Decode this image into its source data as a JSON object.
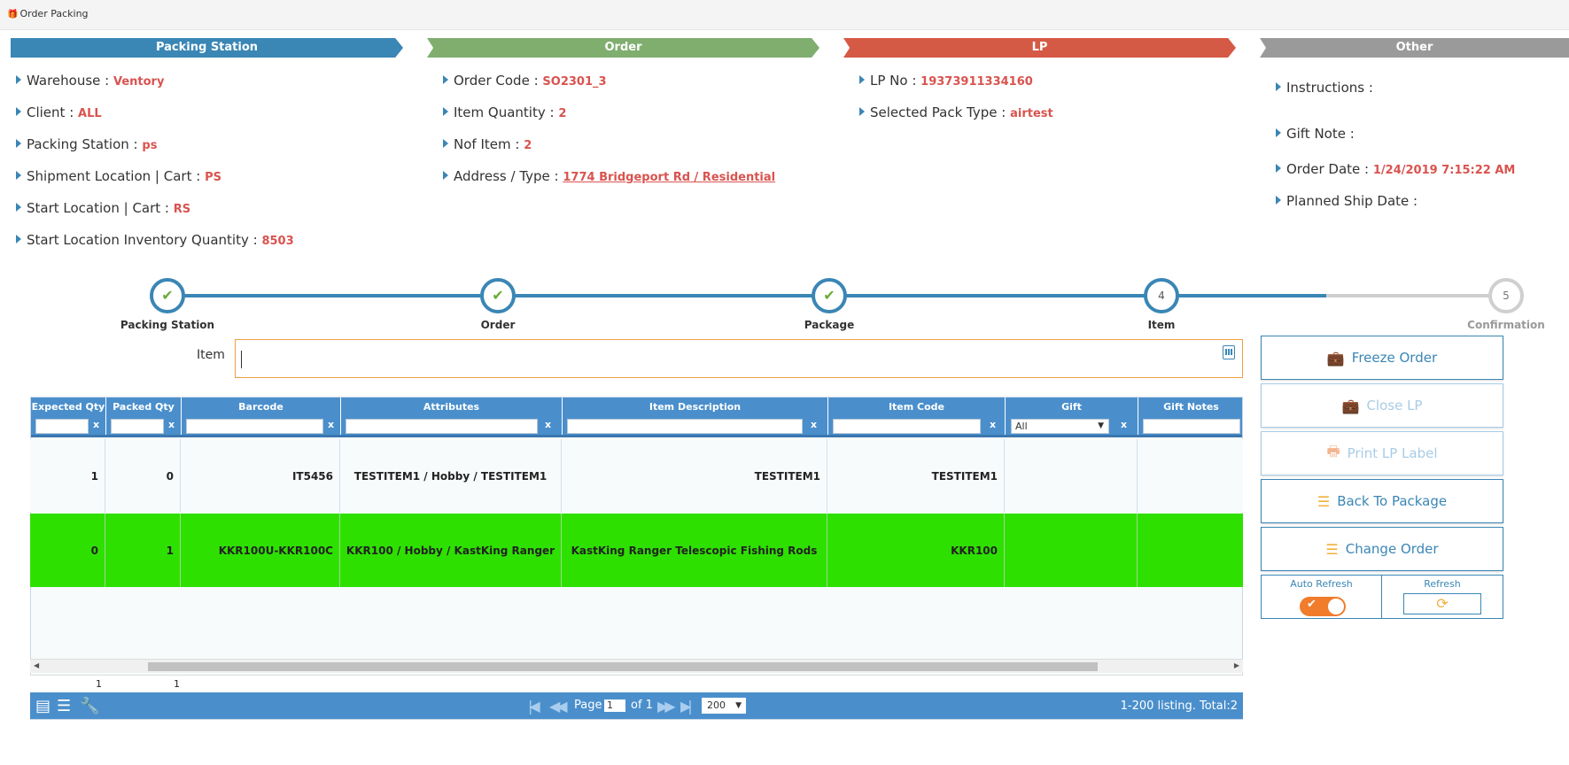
{
  "window": {
    "title": "Order Packing"
  },
  "banners": {
    "packing_station": "Packing Station",
    "order": "Order",
    "lp": "LP",
    "other": "Other"
  },
  "packing_station": {
    "warehouse_label": "Warehouse :",
    "warehouse": "Ventory",
    "client_label": "Client :",
    "client": "ALL",
    "station_label": "Packing Station :",
    "station": "ps",
    "shipment_label": "Shipment Location | Cart :",
    "shipment": "PS",
    "start_label": "Start Location | Cart :",
    "start": "RS",
    "inventory_label": "Start Location Inventory Quantity :",
    "inventory": "8503"
  },
  "order": {
    "code_label": "Order Code :",
    "code": "SO2301_3",
    "qty_label": "Item Quantity :",
    "qty": "2",
    "nof_label": "Nof Item :",
    "nof": "2",
    "address_label": "Address / Type :",
    "address": "1774 Bridgeport Rd / Residential"
  },
  "lp": {
    "no_label": "LP No :",
    "no": "19373911334160",
    "pack_label": "Selected Pack Type :",
    "pack": "airtest"
  },
  "other": {
    "instructions_label": "Instructions :",
    "gift_label": "Gift Note :",
    "date_label": "Order Date :",
    "date": "1/24/2019 7:15:22 AM",
    "ship_label": "Planned Ship Date :"
  },
  "steps": [
    {
      "label": "Packing Station",
      "number": "1",
      "state": "done"
    },
    {
      "label": "Order",
      "number": "2",
      "state": "done"
    },
    {
      "label": "Package",
      "number": "3",
      "state": "done"
    },
    {
      "label": "Item",
      "number": "4",
      "state": "current"
    },
    {
      "label": "Confirmation",
      "number": "5",
      "state": "pending"
    }
  ],
  "item_input": {
    "label": "Item",
    "value": ""
  },
  "grid": {
    "columns": [
      "Expected Qty",
      "Packed Qty",
      "Barcode",
      "Attributes",
      "Item Description",
      "Item Code",
      "Gift",
      "Gift Notes"
    ],
    "gift_filter": "All",
    "rows": [
      [
        "1",
        "0",
        "IT5456",
        "TESTITEM1 / Hobby / TESTITEM1",
        "TESTITEM1",
        "TESTITEM1",
        "",
        ""
      ],
      [
        "0",
        "1",
        "KKR100U-KKR100C",
        "KKR100 / Hobby / KastKing Ranger",
        "KastKing Ranger Telescopic Fishing Rods",
        "KKR100",
        "",
        ""
      ]
    ],
    "totals": {
      "expected": "1",
      "packed": "1"
    },
    "pager": {
      "page_label": "Page",
      "page": "1",
      "of_label": "of 1",
      "page_size": "200",
      "listing": "1-200 listing. Total:2"
    }
  },
  "actions": {
    "freeze": "Freeze Order",
    "close_lp": "Close LP",
    "print_lp": "Print LP Label",
    "back": "Back To Package",
    "change": "Change Order",
    "auto_refresh": "Auto Refresh",
    "refresh": "Refresh"
  },
  "colors": {
    "accent": "#3a86b5",
    "order": "#7fae6f",
    "lp": "#d55a45",
    "other": "#9a9a9a",
    "value": "#d9534f",
    "highlight_row": "#2ee000"
  }
}
